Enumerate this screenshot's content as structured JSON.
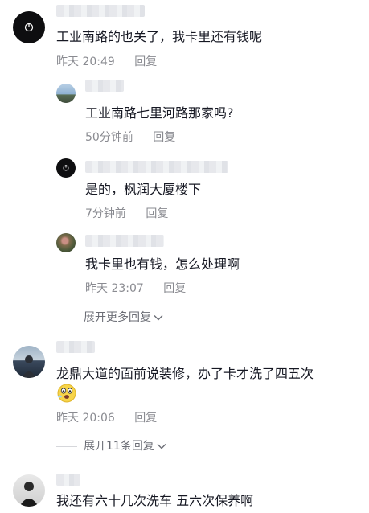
{
  "comments": [
    {
      "text": "工业南路的也关了，我卡里还有钱呢",
      "time": "昨天 20:49",
      "reply_label": "回复",
      "replies": [
        {
          "text": "工业南路七里河路那家吗?",
          "time": "50分钟前",
          "reply_label": "回复"
        },
        {
          "text": "是的，枫润大厦楼下",
          "time": "7分钟前",
          "reply_label": "回复"
        },
        {
          "text": "我卡里也有钱，怎么处理啊",
          "time": "昨天 23:07",
          "reply_label": "回复"
        }
      ],
      "expand_label": "展开更多回复"
    },
    {
      "text": "龙鼎大道的面前说装修，办了卡才洗了四五次",
      "time": "昨天 20:06",
      "reply_label": "回复",
      "expand_label": "展开11条回复"
    },
    {
      "text": "我还有六十几次洗车 五六次保养啊"
    }
  ],
  "colors": {
    "text": "#161823",
    "meta": "#8a8b91",
    "divider": "#d6d7db"
  }
}
